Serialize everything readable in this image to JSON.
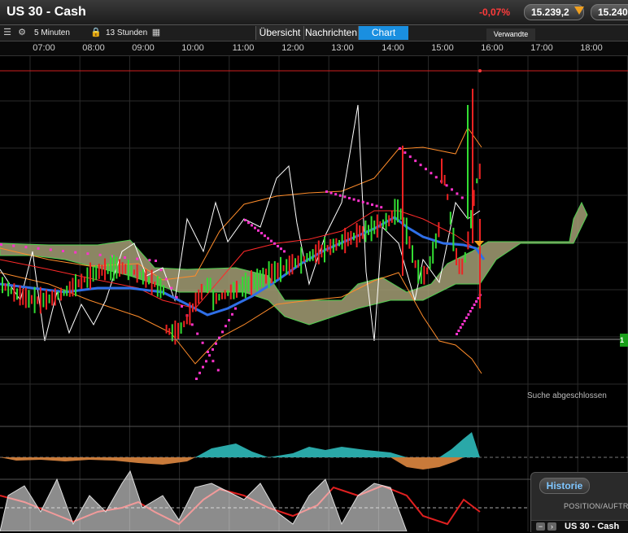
{
  "window": {
    "title": "US 30 - Cash"
  },
  "quote": {
    "change": "-0,07%",
    "bid": "15.239,2",
    "ask": "15.240,"
  },
  "toolbar": {
    "interval": "5 Minuten",
    "range": "13 Stunden",
    "tabs": [
      {
        "label": "Übersicht",
        "active": false
      },
      {
        "label": "Nachrichten",
        "active": false
      },
      {
        "label": "Chart",
        "active": true
      }
    ],
    "related": "Verwandte"
  },
  "time_axis": {
    "ticks": [
      "07:00",
      "08:00",
      "09:00",
      "10:00",
      "11:00",
      "12:00",
      "13:00",
      "14:00",
      "15:00",
      "16:00",
      "17:00",
      "18:00"
    ]
  },
  "chart": {
    "status": "Suche abgeschlossen",
    "last_price_tag": "1",
    "colors": {
      "bull": "#33dd33",
      "bear": "#ee2222",
      "ma": "#2f6fe8",
      "cloud": "#a39e74",
      "psar": "#ff33cc",
      "band": "#ff8c2a"
    }
  },
  "panel": {
    "tab": "Historie",
    "header": "POSITION/AUFTRA",
    "row": "US 30 - Cash"
  }
}
